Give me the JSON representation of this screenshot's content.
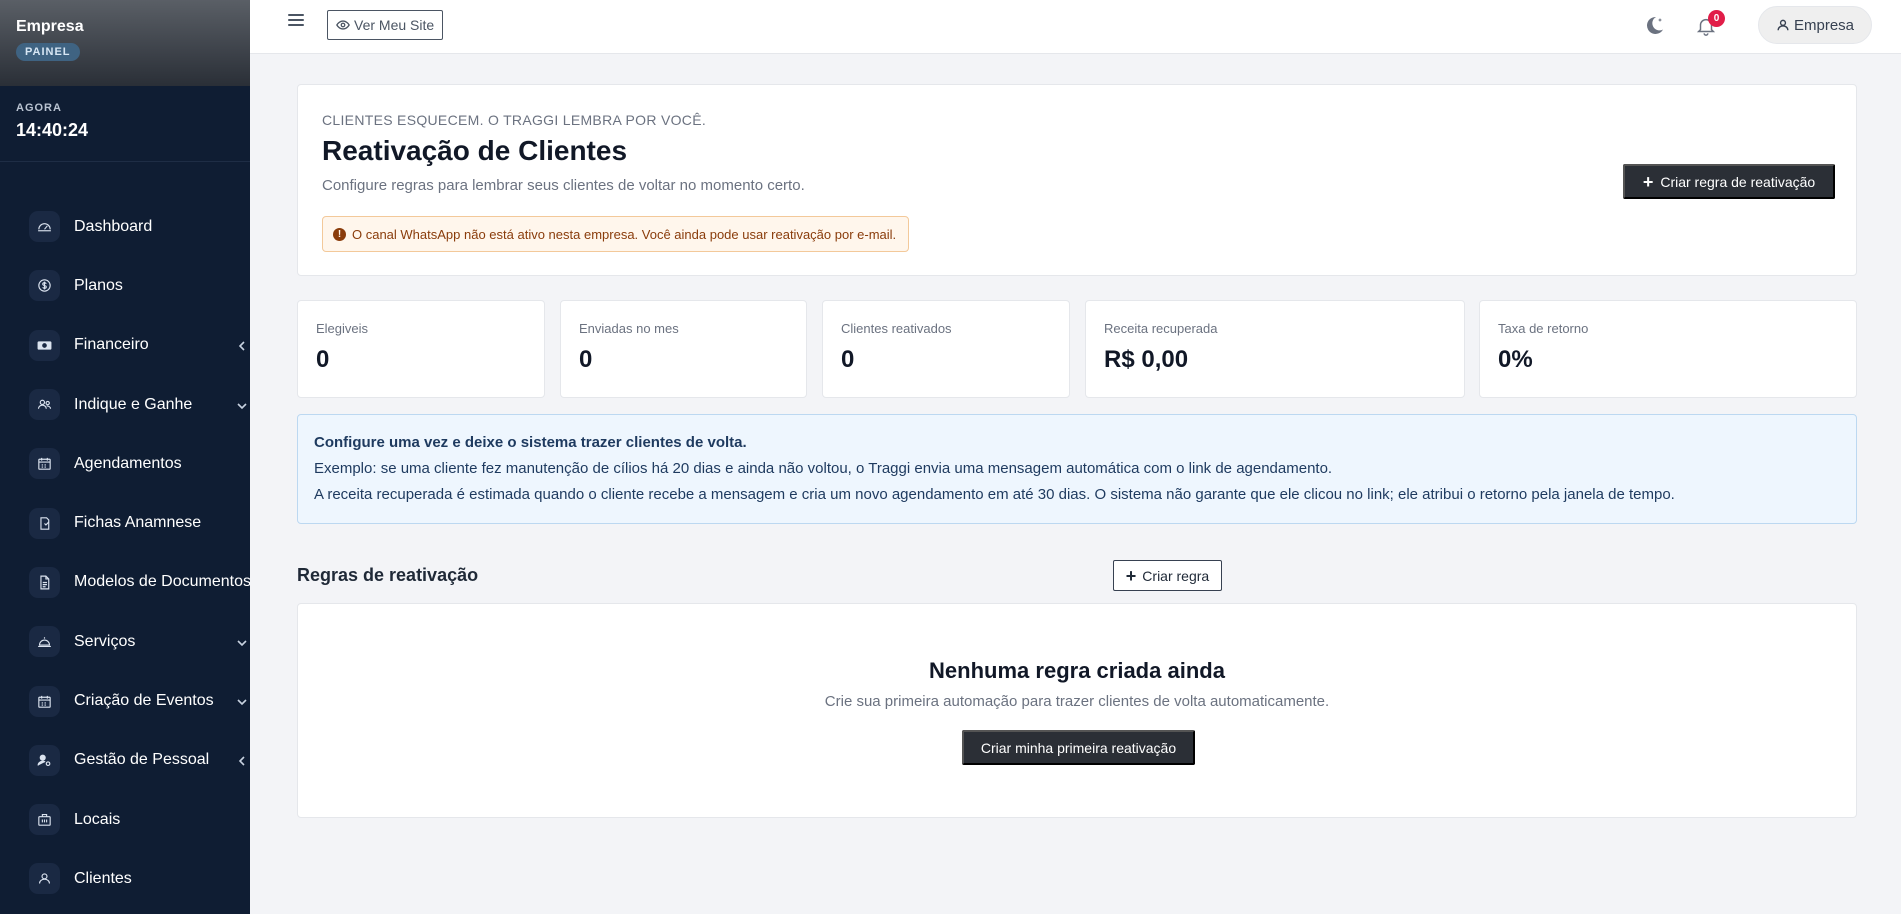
{
  "sidebar": {
    "brand_name": "Empresa",
    "brand_badge": "PAINEL",
    "clock_label": "AGORA",
    "clock_time": "14:40:24",
    "items": [
      {
        "label": "Dashboard",
        "icon": "gauge-icon",
        "chevron": "none"
      },
      {
        "label": "Planos",
        "icon": "dollar-circle-icon",
        "chevron": "none"
      },
      {
        "label": "Financeiro",
        "icon": "money-bill-icon",
        "chevron": "left"
      },
      {
        "label": "Indique e Ganhe",
        "icon": "users-icon",
        "chevron": "down"
      },
      {
        "label": "Agendamentos",
        "icon": "calendar-icon",
        "chevron": "none"
      },
      {
        "label": "Fichas Anamnese",
        "icon": "clipboard-icon",
        "chevron": "none"
      },
      {
        "label": "Modelos de Documentos",
        "icon": "document-icon",
        "chevron": "none"
      },
      {
        "label": "Serviços",
        "icon": "service-bell-icon",
        "chevron": "down"
      },
      {
        "label": "Criação de Eventos",
        "icon": "calendar-icon",
        "chevron": "down"
      },
      {
        "label": "Gestão de Pessoal",
        "icon": "user-gear-icon",
        "chevron": "left"
      },
      {
        "label": "Locais",
        "icon": "building-icon",
        "chevron": "none"
      },
      {
        "label": "Clientes",
        "icon": "user-icon",
        "chevron": "none"
      }
    ]
  },
  "topbar": {
    "site_button": "Ver Meu Site",
    "notification_count": "0",
    "user_label": "Empresa"
  },
  "hero": {
    "eyebrow": "CLIENTES ESQUECEM. O TRAGGI LEMBRA POR VOCÊ.",
    "title": "Reativação de Clientes",
    "subtitle": "Configure regras para lembrar seus clientes de voltar no momento certo.",
    "alert": "O canal WhatsApp não está ativo nesta empresa. Você ainda pode usar reativação por e-mail.",
    "create_button": "Criar regra de reativação"
  },
  "stats": [
    {
      "label": "Elegiveis",
      "value": "0"
    },
    {
      "label": "Enviadas no mes",
      "value": "0"
    },
    {
      "label": "Clientes reativados",
      "value": "0"
    },
    {
      "label": "Receita recuperada",
      "value": "R$ 0,00"
    },
    {
      "label": "Taxa de retorno",
      "value": "0%"
    }
  ],
  "info": {
    "title": "Configure uma vez e deixe o sistema trazer clientes de volta.",
    "line1": "Exemplo: se uma cliente fez manutenção de cílios há 20 dias e ainda não voltou, o Traggi envia uma mensagem automática com o link de agendamento.",
    "line2": "A receita recuperada é estimada quando o cliente recebe a mensagem e cria um novo agendamento em até 30 dias. O sistema não garante que ele clicou no link; ele atribui o retorno pela janela de tempo."
  },
  "rules": {
    "title": "Regras de reativação",
    "create_button": "Criar regra",
    "empty_title": "Nenhuma regra criada ainda",
    "empty_subtitle": "Crie sua primeira automação para trazer clientes de volta automaticamente.",
    "empty_button": "Criar minha primeira reativação"
  }
}
